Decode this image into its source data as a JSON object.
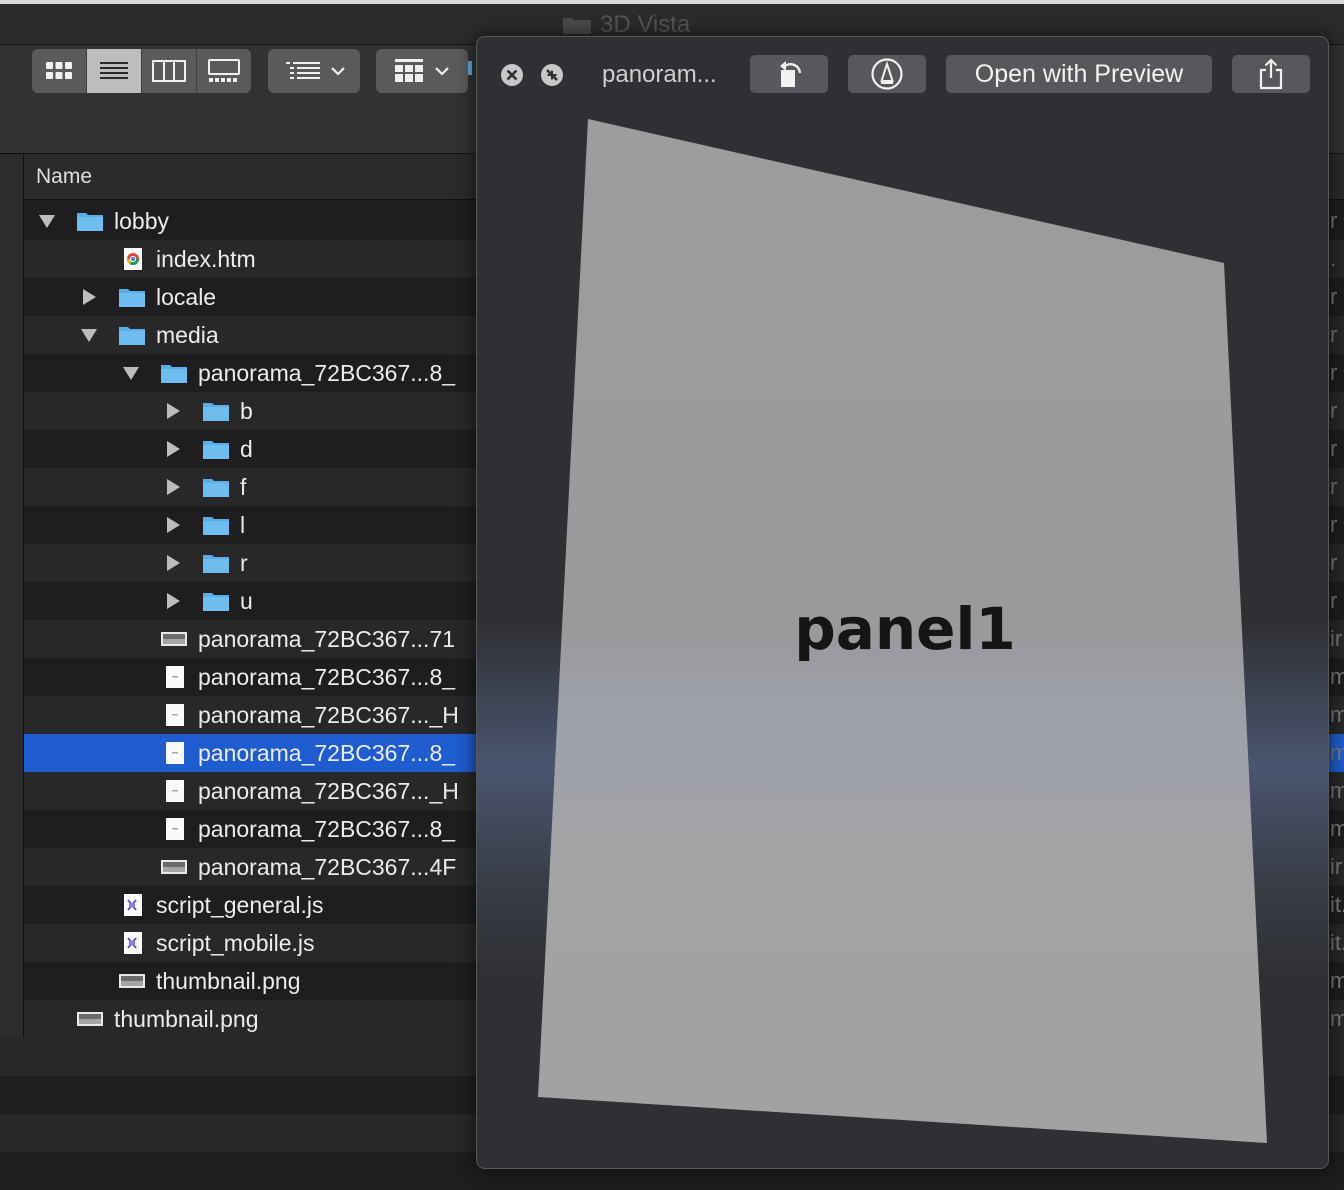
{
  "window": {
    "title": "3D Vista"
  },
  "toolbar": {
    "view_modes": [
      "icon-view",
      "list-view",
      "column-view",
      "gallery-view"
    ],
    "active_view": "list-view"
  },
  "columns": {
    "name": "Name"
  },
  "files": [
    {
      "label": "lobby",
      "indent": 0,
      "disclosure": "open",
      "icon": "folder-icon"
    },
    {
      "label": "index.htm",
      "indent": 1,
      "disclosure": "none",
      "icon": "chrome-file-icon"
    },
    {
      "label": "locale",
      "indent": 1,
      "disclosure": "closed",
      "icon": "folder-icon"
    },
    {
      "label": "media",
      "indent": 1,
      "disclosure": "open",
      "icon": "folder-icon"
    },
    {
      "label": "panorama_72BC367...8_",
      "indent": 2,
      "disclosure": "open",
      "icon": "folder-icon"
    },
    {
      "label": "b",
      "indent": 3,
      "disclosure": "closed",
      "icon": "folder-icon"
    },
    {
      "label": "d",
      "indent": 3,
      "disclosure": "closed",
      "icon": "folder-icon"
    },
    {
      "label": "f",
      "indent": 3,
      "disclosure": "closed",
      "icon": "folder-icon"
    },
    {
      "label": "l",
      "indent": 3,
      "disclosure": "closed",
      "icon": "folder-icon"
    },
    {
      "label": "r",
      "indent": 3,
      "disclosure": "closed",
      "icon": "folder-icon"
    },
    {
      "label": "u",
      "indent": 3,
      "disclosure": "closed",
      "icon": "folder-icon"
    },
    {
      "label": "panorama_72BC367...71",
      "indent": 2,
      "disclosure": "none",
      "icon": "image-file-icon"
    },
    {
      "label": "panorama_72BC367...8_",
      "indent": 2,
      "disclosure": "none",
      "icon": "blank-file-icon"
    },
    {
      "label": "panorama_72BC367..._H",
      "indent": 2,
      "disclosure": "none",
      "icon": "blank-file-icon"
    },
    {
      "label": "panorama_72BC367...8_",
      "indent": 2,
      "disclosure": "none",
      "icon": "blank-file-icon",
      "selected": true
    },
    {
      "label": "panorama_72BC367..._H",
      "indent": 2,
      "disclosure": "none",
      "icon": "blank-file-icon"
    },
    {
      "label": "panorama_72BC367...8_",
      "indent": 2,
      "disclosure": "none",
      "icon": "blank-file-icon"
    },
    {
      "label": "panorama_72BC367...4F",
      "indent": 2,
      "disclosure": "none",
      "icon": "image-file-icon"
    },
    {
      "label": "script_general.js",
      "indent": 1,
      "disclosure": "none",
      "icon": "js-file-icon"
    },
    {
      "label": "script_mobile.js",
      "indent": 1,
      "disclosure": "none",
      "icon": "js-file-icon"
    },
    {
      "label": "thumbnail.png",
      "indent": 1,
      "disclosure": "none",
      "icon": "image-file-icon"
    },
    {
      "label": "thumbnail.png",
      "indent": 0,
      "disclosure": "none",
      "icon": "image-file-icon"
    }
  ],
  "kind_column_fragments": [
    "r",
    ". f",
    "r",
    "r",
    "r",
    "r",
    "r",
    "r",
    "r",
    "r",
    "r",
    "ir",
    "m",
    "m",
    "m",
    "m",
    "m",
    "ir",
    "it.",
    "it.",
    "m",
    "m"
  ],
  "quicklook": {
    "title": "panoram...",
    "open_with_label": "Open with Preview",
    "preview_text": "panel1"
  },
  "colors": {
    "selection": "#1f5ccf",
    "folder": "#5aaee6"
  }
}
